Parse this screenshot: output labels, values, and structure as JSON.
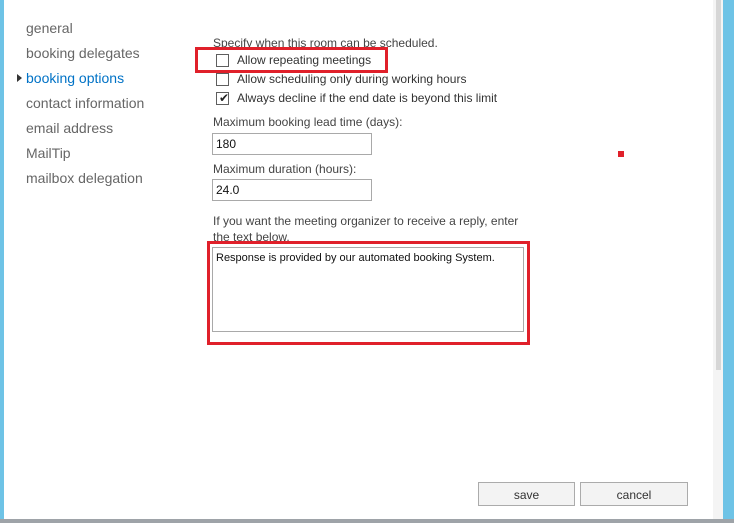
{
  "nav": {
    "items": [
      {
        "label": "general"
      },
      {
        "label": "booking delegates"
      },
      {
        "label": "booking options"
      },
      {
        "label": "contact information"
      },
      {
        "label": "email address"
      },
      {
        "label": "MailTip"
      },
      {
        "label": "mailbox delegation"
      }
    ],
    "active_index": 2
  },
  "booking": {
    "intro": "Specify when this room can be scheduled.",
    "options": [
      {
        "label": "Allow repeating meetings",
        "checked": false
      },
      {
        "label": "Allow scheduling only during working hours",
        "checked": false
      },
      {
        "label": "Always decline if the end date is beyond this limit",
        "checked": true
      }
    ],
    "lead_time": {
      "label": "Maximum booking lead time (days):",
      "value": "180"
    },
    "duration": {
      "label": "Maximum duration (hours):",
      "value": "24.0"
    },
    "reply": {
      "label_line1": "If you want the meeting organizer to receive a reply, enter",
      "label_line2": "the text below.",
      "value": "Response is provided by our automated booking System."
    }
  },
  "buttons": {
    "save": "save",
    "cancel": "cancel"
  },
  "colors": {
    "accent": "#0072c6",
    "highlight": "#e0202a",
    "frame": "#6ec3e6"
  }
}
